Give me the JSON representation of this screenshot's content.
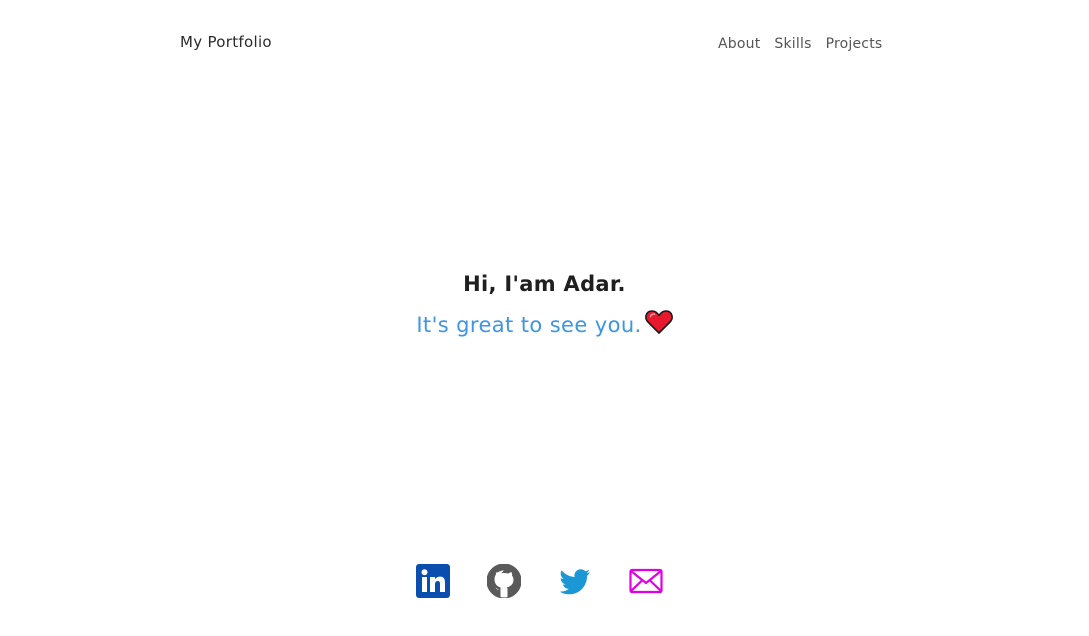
{
  "header": {
    "brand": "My Portfolio",
    "nav": [
      "About",
      "Skills",
      "Projects"
    ]
  },
  "hero": {
    "title": "Hi, I'am Adar.",
    "subtitle": "It's great to see you.",
    "emoji": "heart-icon"
  },
  "socials": [
    {
      "icon": "linkedin-icon",
      "color": "#0a66c2"
    },
    {
      "icon": "github-icon",
      "color": "#555555"
    },
    {
      "icon": "twitter-icon",
      "color": "#1da1f2"
    },
    {
      "icon": "mail-icon",
      "color": "#e100e6"
    }
  ],
  "colors": {
    "accent": "#3b96e6",
    "text": "#222222"
  }
}
